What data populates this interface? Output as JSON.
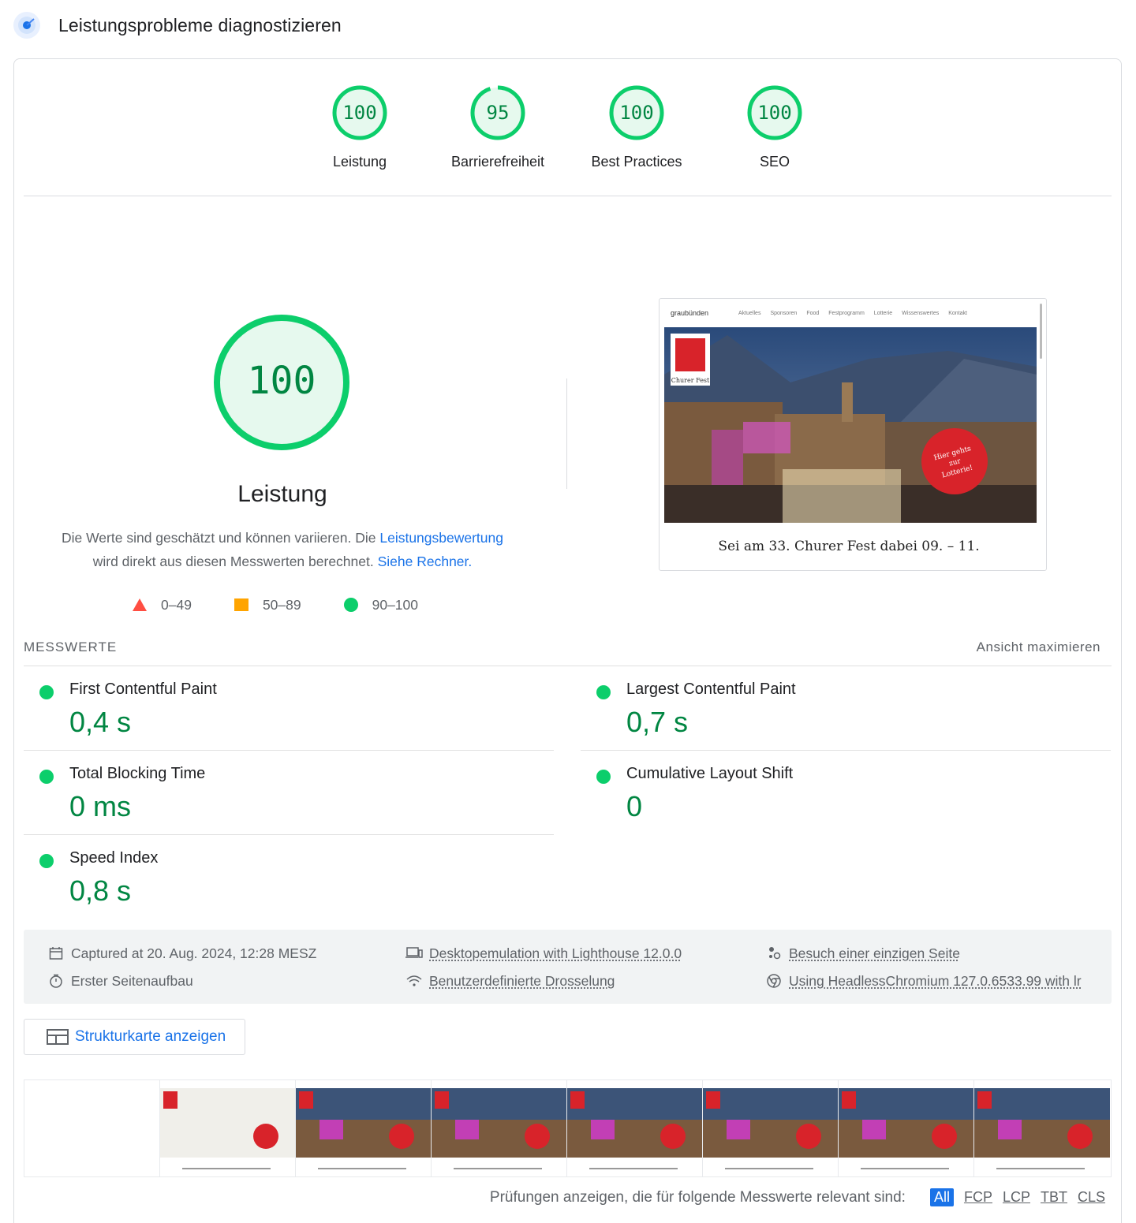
{
  "header": {
    "title": "Leistungsprobleme diagnostizieren"
  },
  "gauges": [
    {
      "score": "100",
      "label": "Leistung",
      "fraction": 1.0
    },
    {
      "score": "95",
      "label": "Barrierefreiheit",
      "fraction": 0.95
    },
    {
      "score": "100",
      "label": "Best Practices",
      "fraction": 1.0
    },
    {
      "score": "100",
      "label": "SEO",
      "fraction": 1.0
    }
  ],
  "performance": {
    "score": "100",
    "title": "Leistung",
    "desc_part1": "Die Werte sind geschätzt und können variieren. Die ",
    "desc_link1": "Leistungsbewertung",
    "desc_part2": "wird direkt aus diesen Messwerten berechnet. ",
    "desc_link2": "Siehe Rechner."
  },
  "legend": {
    "fail": "0–49",
    "average": "50–89",
    "pass": "90–100"
  },
  "screenshot": {
    "brand": "graubünden",
    "nav": [
      "Aktuelles",
      "Sponsoren",
      "Food",
      "Festprogramm",
      "Lotterie",
      "Wissenswertes",
      "Kontakt"
    ],
    "badge_line1": "Hier gehts",
    "badge_line2": "zur",
    "badge_line3": "Lotterie!",
    "logo_text": "Churer Fest",
    "caption": "Sei am 33. Churer Fest dabei 09. – 11."
  },
  "metrics": {
    "section_title": "MESSWERTE",
    "expand_label": "Ansicht maximieren",
    "items": [
      {
        "name": "First Contentful Paint",
        "value": "0,4 s"
      },
      {
        "name": "Largest Contentful Paint",
        "value": "0,7 s"
      },
      {
        "name": "Total Blocking Time",
        "value": "0 ms"
      },
      {
        "name": "Cumulative Layout Shift",
        "value": "0"
      },
      {
        "name": "Speed Index",
        "value": "0,8 s"
      }
    ]
  },
  "runinfo": {
    "captured": "Captured at 20. Aug. 2024, 12:28 MESZ",
    "pageload": "Erster Seitenaufbau",
    "emulation": "Desktopemulation with Lighthouse 12.0.0",
    "throttling": "Benutzerdefinierte Drosselung",
    "session": "Besuch einer einzigen Seite",
    "browser": "Using HeadlessChromium 127.0.6533.99 with lr"
  },
  "treemap": {
    "label": "Strukturkarte anzeigen"
  },
  "filter": {
    "label": "Prüfungen anzeigen, die für folgende Messwerte relevant sind:",
    "chips": [
      "All",
      "FCP",
      "LCP",
      "TBT",
      "CLS"
    ]
  },
  "colors": {
    "pass": "#0cce6b",
    "average": "#ffa400",
    "fail": "#ff4e42",
    "link": "#1a73e8",
    "pass_text": "#018642"
  }
}
